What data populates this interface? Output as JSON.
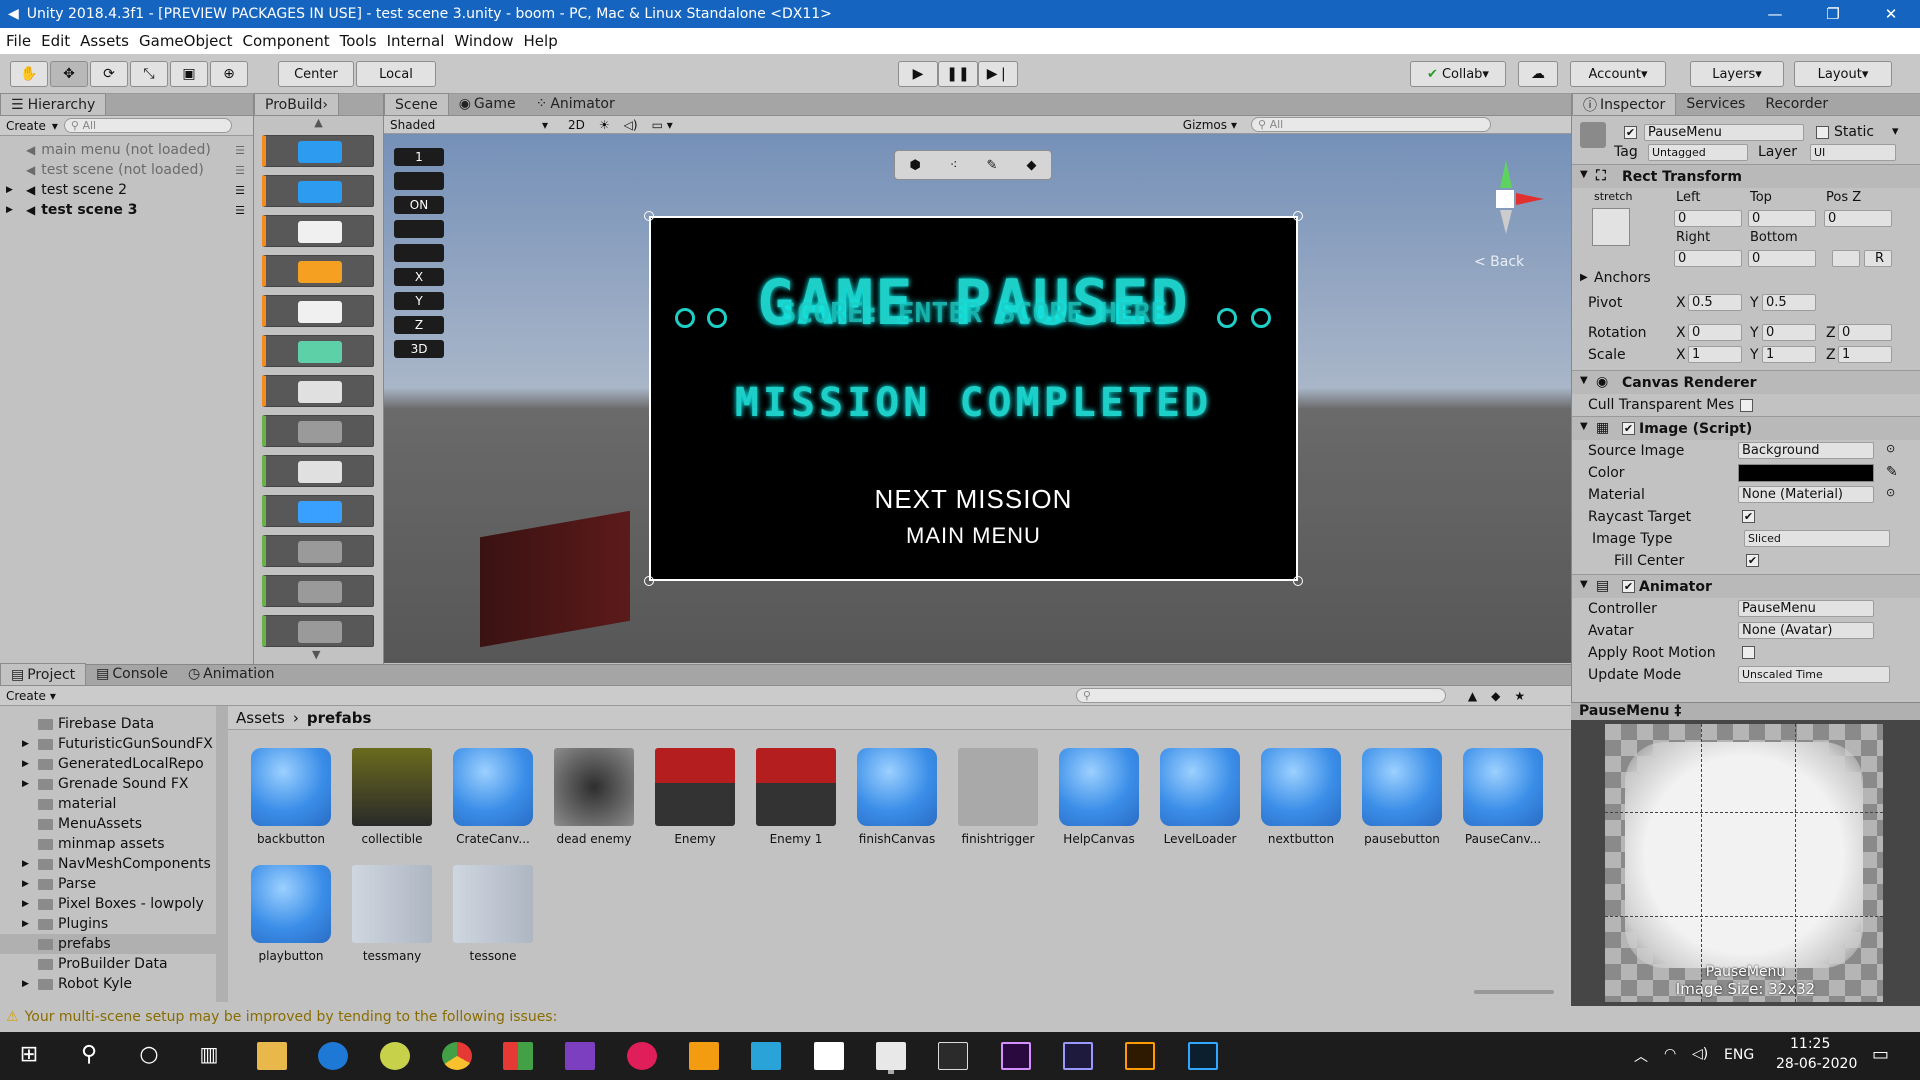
{
  "window": {
    "title": "Unity 2018.4.3f1 - [PREVIEW PACKAGES IN USE] - test scene 3.unity - boom - PC, Mac & Linux Standalone <DX11>",
    "controls": [
      "—",
      "❐",
      "✕"
    ]
  },
  "menu": [
    "File",
    "Edit",
    "Assets",
    "GameObject",
    "Component",
    "Tools",
    "Internal",
    "Window",
    "Help"
  ],
  "toolbar": {
    "center_label": "Center",
    "local_label": "Local",
    "collab_label": "Collab",
    "account_label": "Account",
    "layers_label": "Layers",
    "layout_label": "Layout"
  },
  "hierarchy": {
    "tab": "Hierarchy",
    "create": "Create",
    "search_placeholder": "All",
    "items": [
      {
        "label": "main menu (not loaded)",
        "style": "dim"
      },
      {
        "label": "test scene (not loaded)",
        "style": "dim"
      },
      {
        "label": "test scene 2",
        "style": "normal"
      },
      {
        "label": "test scene 3",
        "style": "bold"
      }
    ]
  },
  "probuilder": {
    "tab": "ProBuild"
  },
  "scene_tabs": {
    "scene": "Scene",
    "game": "Game",
    "animator": "Animator"
  },
  "scene_bar": {
    "shading": "Shaded",
    "mode2d": "2D",
    "gizmos": "Gizmos",
    "search_placeholder": "All"
  },
  "scene_stats": [
    "1",
    "",
    "ON",
    "",
    "",
    "X",
    "Y",
    "Z",
    "3D"
  ],
  "scene": {
    "back_label": "< Back"
  },
  "game_canvas": {
    "title": "GAME PAUSED",
    "overlay_score": "SCORE: ENTER SCORE HERE",
    "mission": "MISSION COMPLETED",
    "next": "NEXT MISSION",
    "main_menu": "MAIN MENU"
  },
  "inspector": {
    "tabs": {
      "inspector": "Inspector",
      "services": "Services",
      "recorder": "Recorder"
    },
    "object_name": "PauseMenu",
    "static_label": "Static",
    "tag_label": "Tag",
    "tag_value": "Untagged",
    "layer_label": "Layer",
    "layer_value": "UI",
    "rect": {
      "title": "Rect Transform",
      "stretch": "stretch",
      "left": "Left",
      "top": "Top",
      "posz": "Pos Z",
      "left_v": "0",
      "top_v": "0",
      "posz_v": "0",
      "right": "Right",
      "bottom": "Bottom",
      "right_v": "0",
      "bottom_v": "0",
      "anchors": "Anchors",
      "pivot": "Pivot",
      "pivot_x": "0.5",
      "pivot_y": "0.5",
      "rotation": "Rotation",
      "rot_x": "0",
      "rot_y": "0",
      "rot_z": "0",
      "scale": "Scale",
      "sc_x": "1",
      "sc_y": "1",
      "sc_z": "1",
      "r_btn": "R"
    },
    "canvas_renderer": {
      "title": "Canvas Renderer",
      "cull": "Cull Transparent Mes"
    },
    "image": {
      "title": "Image (Script)",
      "source_label": "Source Image",
      "source_value": "Background",
      "color_label": "Color",
      "material_label": "Material",
      "material_value": "None (Material)",
      "raycast_label": "Raycast Target",
      "type_label": "Image Type",
      "type_value": "Sliced",
      "fill_label": "Fill Center"
    },
    "animator": {
      "title": "Animator",
      "controller_label": "Controller",
      "controller_value": "PauseMenu",
      "avatar_label": "Avatar",
      "avatar_value": "None (Avatar)",
      "root_label": "Apply Root Motion",
      "update_label": "Update Mode",
      "update_value": "Unscaled Time"
    },
    "preview": {
      "header": "PauseMenu ‡",
      "name": "PauseMenu",
      "size": "Image Size: 32x32"
    }
  },
  "bottom_tabs": {
    "project": "Project",
    "console": "Console",
    "animation": "Animation"
  },
  "project": {
    "create": "Create",
    "breadcrumb": [
      "Assets",
      "prefabs"
    ],
    "folders": [
      {
        "label": "Firebase Data",
        "expand": false
      },
      {
        "label": "FuturisticGunSoundFX",
        "expand": true
      },
      {
        "label": "GeneratedLocalRepo",
        "expand": true
      },
      {
        "label": "Grenade Sound FX",
        "expand": true
      },
      {
        "label": "material",
        "expand": false
      },
      {
        "label": "MenuAssets",
        "expand": false
      },
      {
        "label": "minmap assets",
        "expand": false
      },
      {
        "label": "NavMeshComponents",
        "expand": true
      },
      {
        "label": "Parse",
        "expand": true
      },
      {
        "label": "Pixel Boxes - lowpoly",
        "expand": true
      },
      {
        "label": "Plugins",
        "expand": true
      },
      {
        "label": "prefabs",
        "expand": false
      },
      {
        "label": "ProBuilder Data",
        "expand": false
      },
      {
        "label": "Robot Kyle",
        "expand": true
      }
    ],
    "assets": [
      {
        "label": "backbutton",
        "kind": "cube"
      },
      {
        "label": "collectible",
        "kind": "box"
      },
      {
        "label": "CrateCanv...",
        "kind": "cube"
      },
      {
        "label": "dead enemy",
        "kind": "debris"
      },
      {
        "label": "Enemy",
        "kind": "enemy"
      },
      {
        "label": "Enemy 1",
        "kind": "enemy"
      },
      {
        "label": "finishCanvas",
        "kind": "cube"
      },
      {
        "label": "finishtrigger",
        "kind": "empty"
      },
      {
        "label": "HelpCanvas",
        "kind": "cube"
      },
      {
        "label": "LevelLoader",
        "kind": "cube"
      },
      {
        "label": "nextbutton",
        "kind": "cube"
      },
      {
        "label": "pausebutton",
        "kind": "cube"
      },
      {
        "label": "PauseCanv...",
        "kind": "cube"
      },
      {
        "label": "playbutton",
        "kind": "cube"
      },
      {
        "label": "tessmany",
        "kind": "gray"
      },
      {
        "label": "tessone",
        "kind": "gray"
      }
    ]
  },
  "status": {
    "warning": "Your multi-scene setup may be improved by tending to the following issues:"
  },
  "taskbar": {
    "lang": "ENG",
    "time": "11:25",
    "date": "28-06-2020"
  },
  "colors": {
    "title_bar": "#1565c0",
    "neon": "#1ecfc8",
    "canvas_bg": "#000000"
  }
}
